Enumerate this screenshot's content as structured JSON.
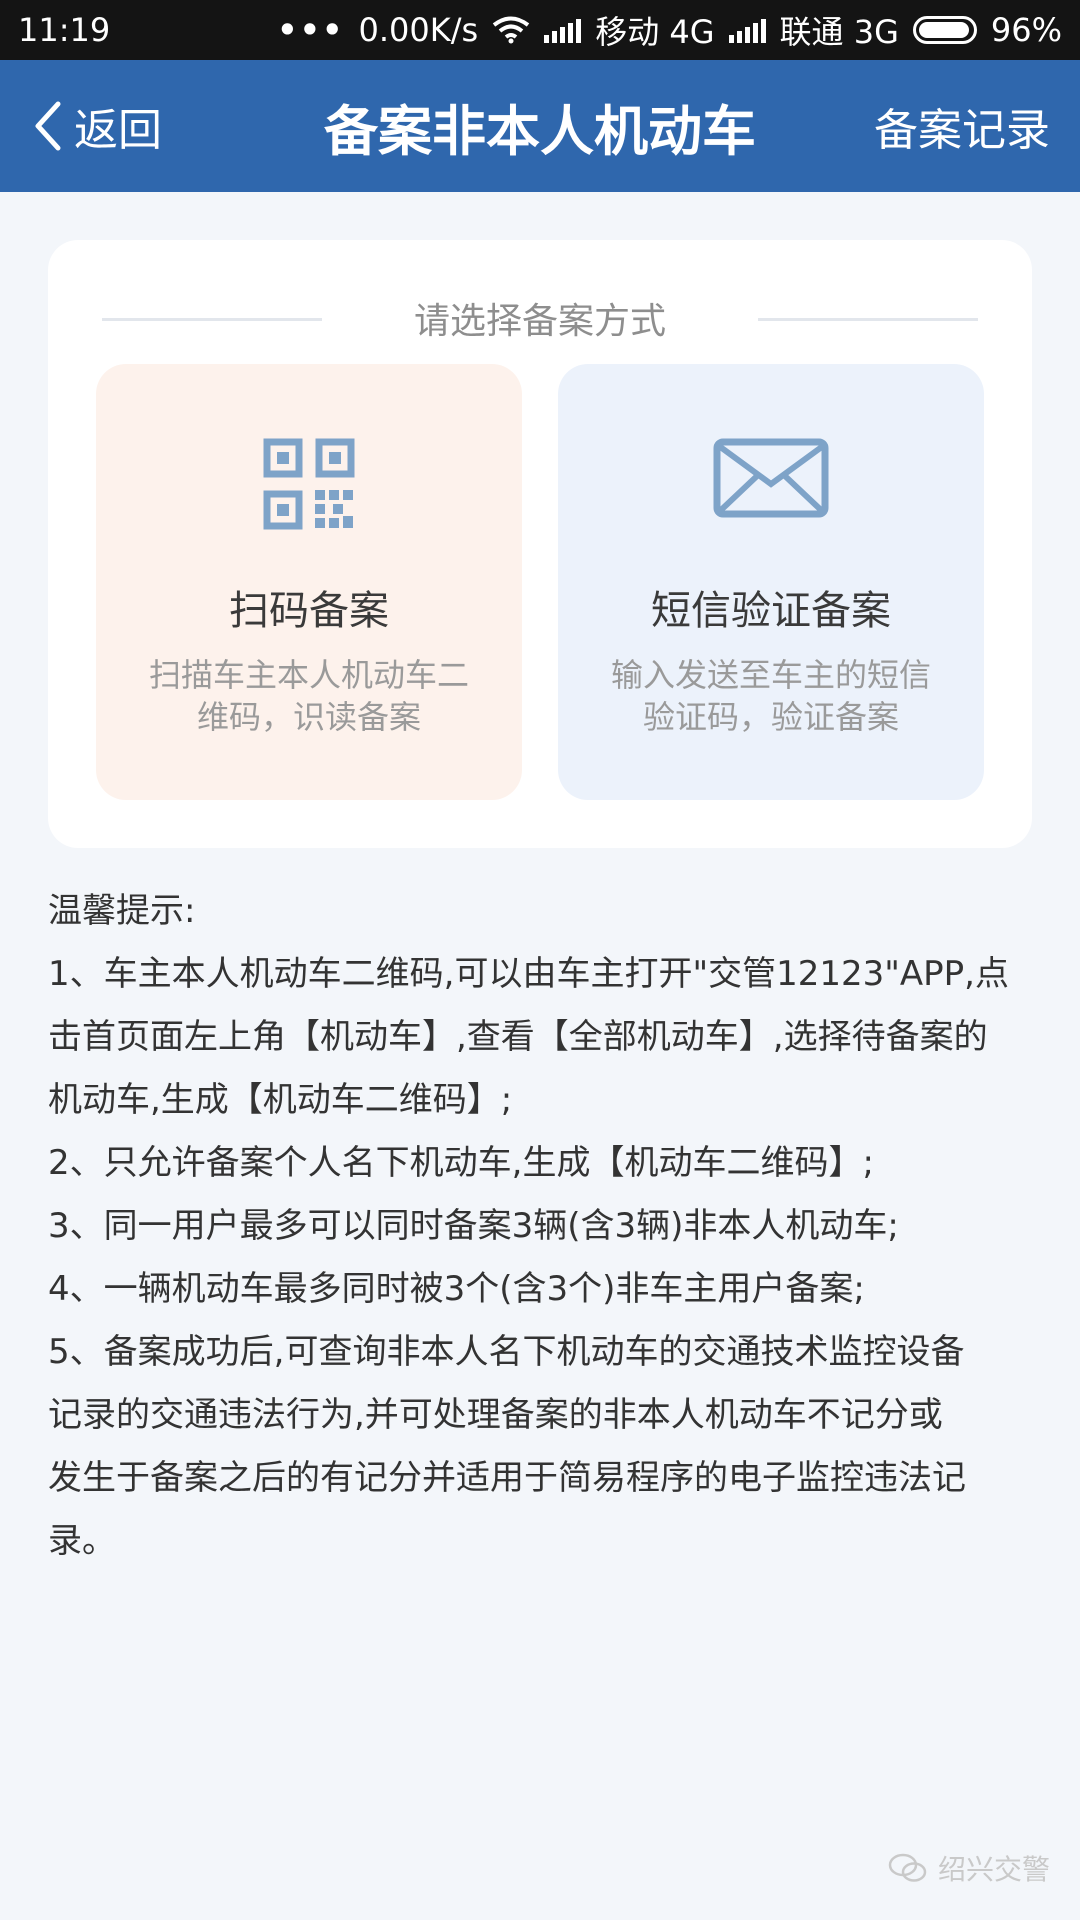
{
  "status_bar": {
    "time": "11:19",
    "speed": "0.00K/s",
    "carrier1": "移动 4G",
    "carrier2": "联通 3G",
    "battery": "96%"
  },
  "nav": {
    "back_label": "返回",
    "title": "备案非本人机动车",
    "records_label": "备案记录"
  },
  "method_card": {
    "header": "请选择备案方式",
    "options": [
      {
        "icon": "qr-code-icon",
        "title": "扫码备案",
        "desc_line1": "扫描车主本人机动车二",
        "desc_line2": "维码，识读备案"
      },
      {
        "icon": "envelope-icon",
        "title": "短信验证备案",
        "desc_line1": "输入发送至车主的短信",
        "desc_line2": "验证码，验证备案"
      }
    ]
  },
  "tips": {
    "heading": "温馨提示:",
    "lines": [
      "1、车主本人机动车二维码,可以由车主打开\"交管12123\"APP,点",
      "击首页面左上角【机动车】,查看【全部机动车】,选择待备案的",
      "机动车,生成【机动车二维码】;",
      "2、只允许备案个人名下机动车,生成【机动车二维码】;",
      "3、同一用户最多可以同时备案3辆(含3辆)非本人机动车;",
      "4、一辆机动车最多同时被3个(含3个)非车主用户备案;",
      "5、备案成功后,可查询非本人名下机动车的交通技术监控设备",
      "记录的交通违法行为,并可处理备案的非本人机动车不记分或",
      "发生于备案之后的有记分并适用于简易程序的电子监控违法记",
      "录。"
    ]
  },
  "watermark": "绍兴交警",
  "colors": {
    "nav_bg": "#2f67ad",
    "icon_blue": "#7ea3c8",
    "scan_bg": "#fdf2ec",
    "sms_bg": "#ecf2fb",
    "page_bg": "#f3f6fa"
  }
}
